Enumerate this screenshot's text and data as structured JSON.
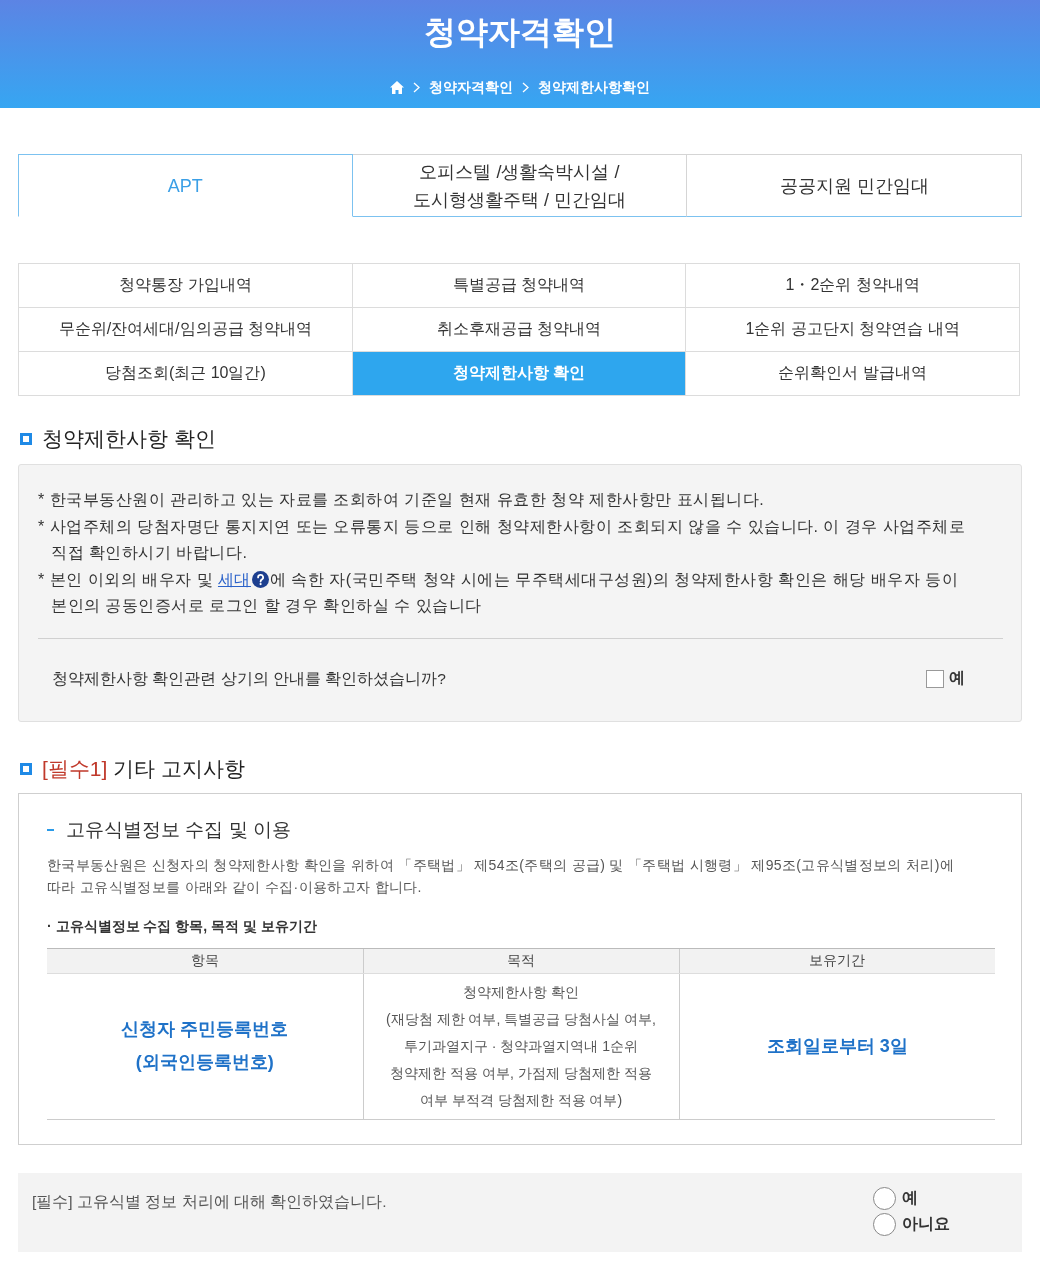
{
  "header": {
    "title": "청약자격확인",
    "breadcrumb": [
      "청약자격확인",
      "청약제한사항확인"
    ]
  },
  "tabs": [
    {
      "label": "APT",
      "selected": true
    },
    {
      "label": "오피스텔 /생활숙박시설 /\n도시형생활주택 / 민간임대",
      "selected": false
    },
    {
      "label": "공공지원 민간임대",
      "selected": false
    }
  ],
  "menu": [
    {
      "label": "청약통장 가입내역",
      "selected": false
    },
    {
      "label": "특별공급 청약내역",
      "selected": false
    },
    {
      "label": "1・2순위 청약내역",
      "selected": false
    },
    {
      "label": "무순위/잔여세대/임의공급 청약내역",
      "selected": false
    },
    {
      "label": "취소후재공급 청약내역",
      "selected": false
    },
    {
      "label": "1순위 공고단지 청약연습 내역",
      "selected": false
    },
    {
      "label": "당첨조회(최근 10일간)",
      "selected": false
    },
    {
      "label": "청약제한사항 확인",
      "selected": true
    },
    {
      "label": "순위확인서 발급내역",
      "selected": false
    }
  ],
  "restriction_section": {
    "title": "청약제한사항 확인",
    "notices": [
      {
        "segments": [
          {
            "kind": "text",
            "text": "* 한국부동산원이 관리하고 있는 자료를 조회하여 기준일 현재 유효한 청약 제한사항만 표시됩니다."
          }
        ]
      },
      {
        "segments": [
          {
            "kind": "text",
            "text": "* 사업주체의 당첨자명단 통지지연 또는 오류통지 등으로 인해 청약제한사항이 조회되지 않을 수 있습니다. 이 경우 사업주체로 직접 확인하시기 바랍니다."
          }
        ]
      },
      {
        "segments": [
          {
            "kind": "text",
            "text": "* 본인 이외의 배우자 및 "
          },
          {
            "kind": "link",
            "text": "세대"
          },
          {
            "kind": "help"
          },
          {
            "kind": "text",
            "text": "에 속한 자(국민주택 청약 시에는 무주택세대구성원)의 청약제한사항 확인은 해당 배우자 등이 본인의 공동인증서로 로그인 할 경우 확인하실 수 있습니다"
          }
        ]
      }
    ],
    "confirm": {
      "question": "청약제한사항 확인관련 상기의 안내를 확인하셨습니까?",
      "option": "예",
      "checked": false
    }
  },
  "notice_section": {
    "tag": "[필수1]",
    "title": "기타 고지사항",
    "subheading": "고유식별정보 수집 및 이용",
    "paragraph": "한국부동산원은 신청자의 청약제한사항 확인을 위하여 「주택법」 제54조(주택의 공급) 및 「주택법 시행령」 제95조(고유식별정보의 처리)에 따라 고유식별정보를 아래와 같이 수집·이용하고자 합니다.",
    "list_item": "· 고유식별정보 수집 항목, 목적 및 보유기간",
    "table": {
      "columns": [
        "항목",
        "목적",
        "보유기간"
      ],
      "rows": [
        [
          {
            "kind": "emphasis",
            "text": "신청자 주민등록번호\n(외국인등록번호)"
          },
          {
            "kind": "plain",
            "text": "청약제한사항 확인\n(재당첨 제한 여부, 특별공급 당첨사실 여부,\n투기과열지구 · 청약과열지역내 1순위\n청약제한 적용 여부, 가점제 당첨제한 적용\n여부 부적격 당첨제한 적용 여부)"
          },
          {
            "kind": "emphasis",
            "text": "조회일로부터 3일"
          }
        ]
      ]
    }
  },
  "agreement": {
    "text": "[필수] 고유식별 정보 처리에 대해 확인하였습니다.",
    "options": [
      {
        "label": "예",
        "selected": false
      },
      {
        "label": "아니요",
        "selected": false
      }
    ]
  }
}
